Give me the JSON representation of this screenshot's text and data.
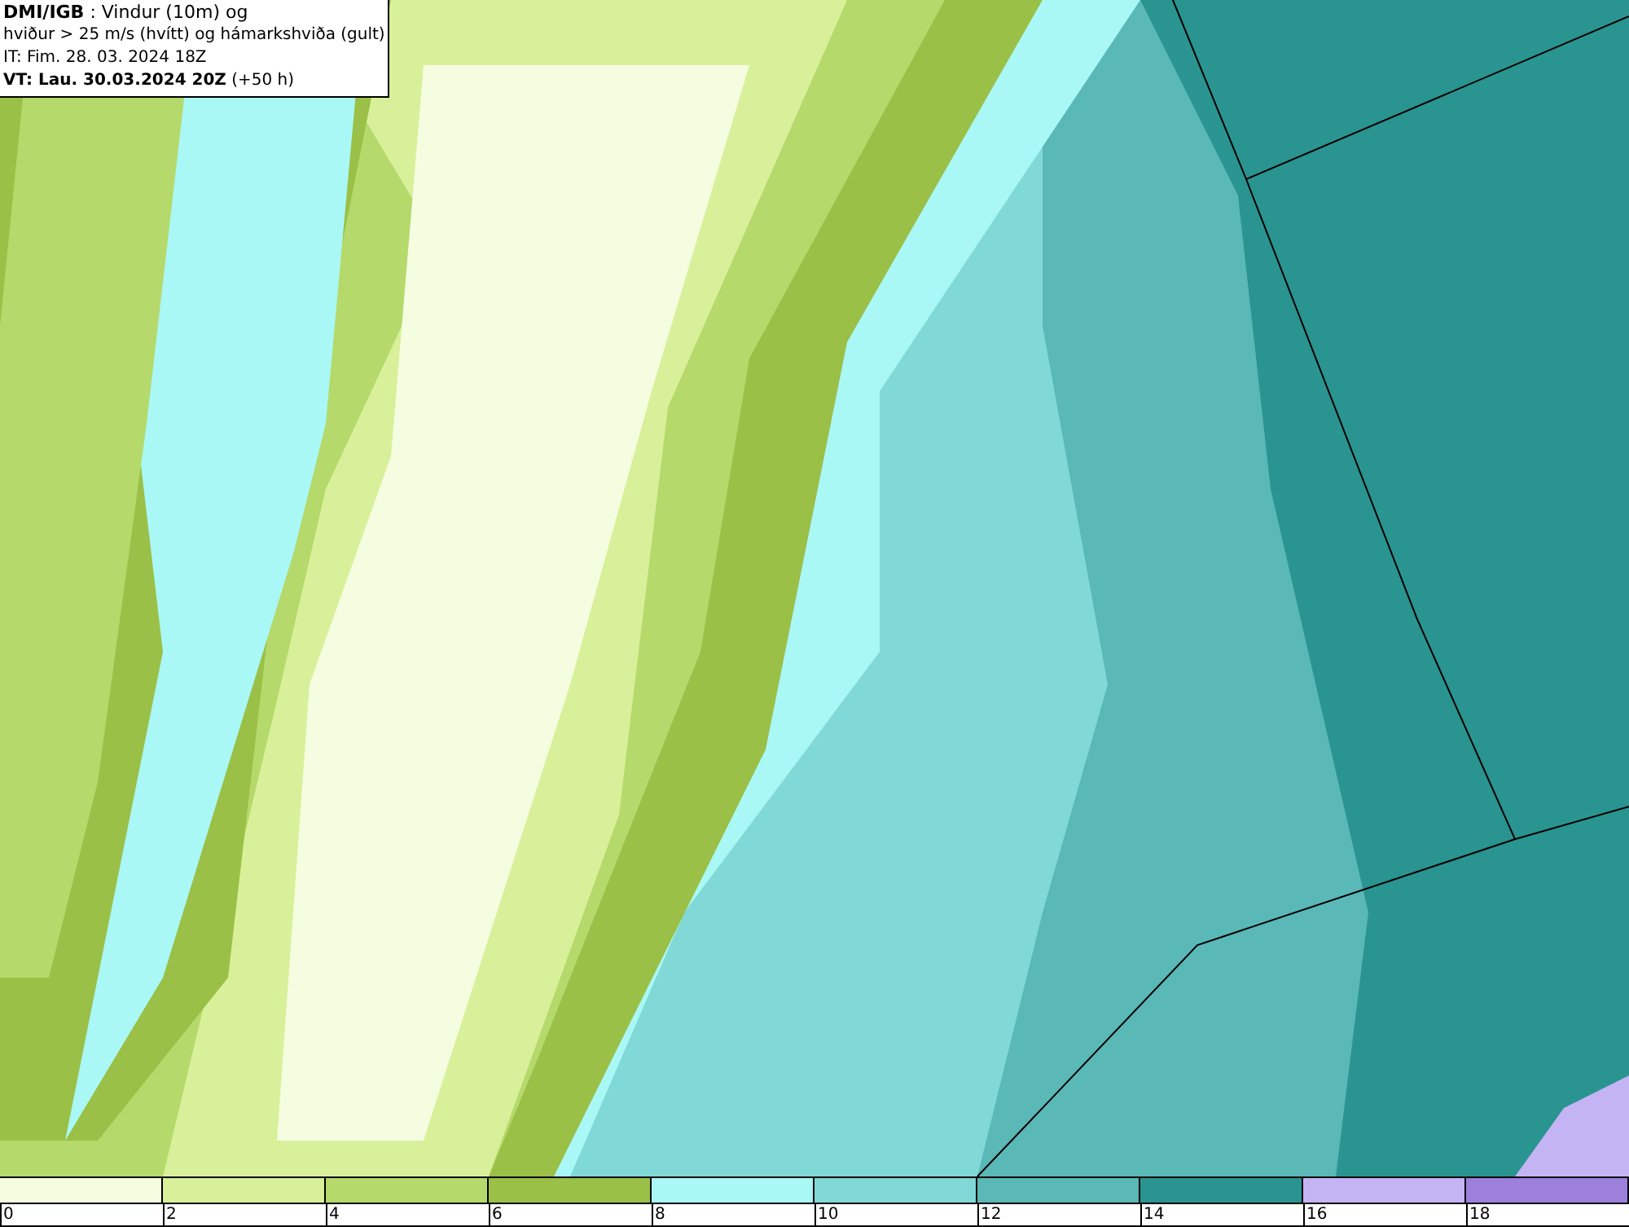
{
  "title_box": {
    "lines": [
      "**DMI/IGB** : Vindur (10m) og",
      "hviður > 25 m/s (hvítt) og hámarkshviða (gult)",
      "IT: Fim. 28. 03. 2024 18Z",
      "**VT: Lau. 30.03.2024 20Z** (+50 h)"
    ]
  },
  "legend": {
    "segments": [
      {
        "color": "#f5fde0",
        "label": "0"
      },
      {
        "color": "#d9f09a",
        "label": "2"
      },
      {
        "color": "#b5d96b",
        "label": "4"
      },
      {
        "color": "#9bc047",
        "label": "6"
      },
      {
        "color": "#aaf8f5",
        "label": "8"
      },
      {
        "color": "#80d9d6",
        "label": "10"
      },
      {
        "color": "#5ab8b6",
        "label": "12"
      },
      {
        "color": "#2a9490",
        "label": "14"
      },
      {
        "color": "#c4b4f4",
        "label": "16"
      },
      {
        "color": "#9c80dc",
        "label": "18"
      }
    ]
  }
}
